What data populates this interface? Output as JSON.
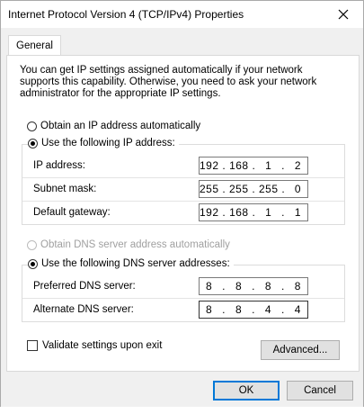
{
  "window": {
    "title": "Internet Protocol Version 4 (TCP/IPv4) Properties",
    "close_icon": "close-icon"
  },
  "tabs": [
    {
      "label": "General",
      "active": true
    }
  ],
  "intro": "You can get IP settings assigned automatically if your network supports this capability. Otherwise, you need to ask your network administrator for the appropriate IP settings.",
  "ip": {
    "auto_label": "Obtain an IP address automatically",
    "manual_label": "Use the following IP address:",
    "fields": [
      {
        "label": "IP address:",
        "octets": [
          "192",
          "168",
          "1",
          "2"
        ]
      },
      {
        "label": "Subnet mask:",
        "octets": [
          "255",
          "255",
          "255",
          "0"
        ]
      },
      {
        "label": "Default gateway:",
        "octets": [
          "192",
          "168",
          "1",
          "1"
        ]
      }
    ]
  },
  "dns": {
    "auto_label": "Obtain DNS server address automatically",
    "manual_label": "Use the following DNS server addresses:",
    "fields": [
      {
        "label": "Preferred DNS server:",
        "octets": [
          "8",
          "8",
          "8",
          "8"
        ]
      },
      {
        "label": "Alternate DNS server:",
        "octets": [
          "8",
          "8",
          "4",
          "4"
        ]
      }
    ]
  },
  "validate_label": "Validate settings upon exit",
  "buttons": {
    "advanced": "Advanced...",
    "ok": "OK",
    "cancel": "Cancel"
  },
  "colors": {
    "accent": "#0078d7",
    "dialog_bg": "#f0f0f0",
    "panel_bg": "#ffffff"
  }
}
